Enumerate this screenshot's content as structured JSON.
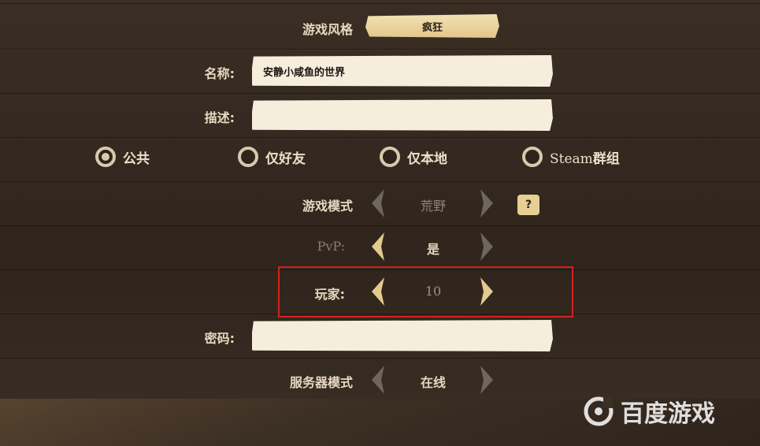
{
  "game_style": {
    "label": "游戏风格",
    "value": "疯狂"
  },
  "name_field": {
    "label": "名称:",
    "value": "安静小咸鱼的世界"
  },
  "desc_field": {
    "label": "描述:",
    "value": ""
  },
  "visibility": {
    "options": [
      {
        "label": "公共",
        "selected": true
      },
      {
        "label": "仅好友",
        "selected": false
      },
      {
        "label": "仅本地",
        "selected": false
      },
      {
        "label_prefix": "Steam",
        "label_suffix": "群组",
        "selected": false
      }
    ]
  },
  "game_mode": {
    "label": "游戏模式",
    "value": "荒野",
    "help_icon": "?"
  },
  "pvp": {
    "label": "PvP:",
    "value": "是"
  },
  "players": {
    "label": "玩家:",
    "value": "10"
  },
  "password": {
    "label": "密码:",
    "value": ""
  },
  "server_mode": {
    "label": "服务器模式",
    "value": "在线"
  },
  "watermark": {
    "text": "百度游戏"
  },
  "colors": {
    "accent": "#e6cf93",
    "highlight": "#d81f1f",
    "background": "#332920"
  }
}
